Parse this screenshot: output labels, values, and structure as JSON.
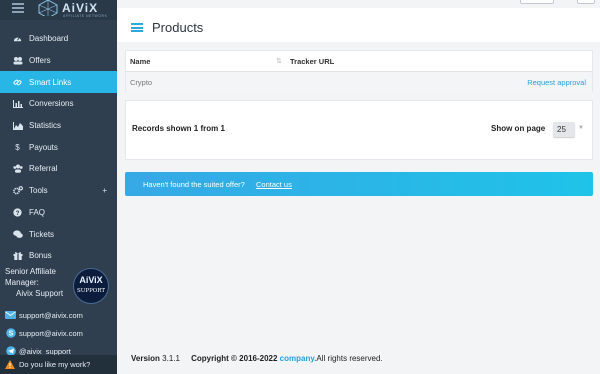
{
  "brand": {
    "name": "AiViX",
    "tagline": "AFFILIATE NETWORK"
  },
  "sidebar": {
    "items": [
      {
        "label": "Dashboard",
        "icon": "dashboard-icon",
        "active": false
      },
      {
        "label": "Offers",
        "icon": "offers-icon",
        "active": false
      },
      {
        "label": "Smart Links",
        "icon": "link-icon",
        "active": true
      },
      {
        "label": "Conversions",
        "icon": "bar-chart-icon",
        "active": false
      },
      {
        "label": "Statistics",
        "icon": "area-chart-icon",
        "active": false
      },
      {
        "label": "Payouts",
        "icon": "dollar-icon",
        "active": false
      },
      {
        "label": "Referral",
        "icon": "users-icon",
        "active": false
      },
      {
        "label": "Tools",
        "icon": "cogs-icon",
        "active": false,
        "expand": "+"
      },
      {
        "label": "FAQ",
        "icon": "question-icon",
        "active": false
      },
      {
        "label": "Tickets",
        "icon": "comments-icon",
        "active": false
      },
      {
        "label": "Bonus",
        "icon": "gift-icon",
        "active": false
      }
    ],
    "manager": {
      "title": "Senior Affiliate Manager:",
      "name": "Aivix Support",
      "avatar_line1": "AiViX",
      "avatar_line2": "SUPPORT"
    },
    "contacts": [
      {
        "icon": "envelope-icon",
        "text": "support@aivix.com"
      },
      {
        "icon": "skype-icon",
        "text": "support@aivix.com"
      },
      {
        "icon": "telegram-icon",
        "text": "@aivix_support"
      }
    ],
    "feedback": {
      "icon": "warning-icon",
      "text": "Do you like my work?"
    }
  },
  "page": {
    "title": "Products"
  },
  "table": {
    "columns": [
      "Name",
      "Tracker URL"
    ],
    "rows": [
      {
        "name": "Crypto",
        "action": "Request approval"
      }
    ]
  },
  "records": {
    "text": "Records shown 1 from 1",
    "show_label": "Show on page",
    "page_size": "25"
  },
  "banner": {
    "text": "Haven't found the suited offer?",
    "link": "Contact us"
  },
  "footer": {
    "version_label": "Version",
    "version": "3.1.1",
    "copyright": "Copyright © 2016-2022",
    "company": "company.",
    "rights": "All rights reserved."
  },
  "colors": {
    "sidebar": "#2f3f4f",
    "accent": "#27b6e5",
    "link": "#2a9fd8"
  }
}
